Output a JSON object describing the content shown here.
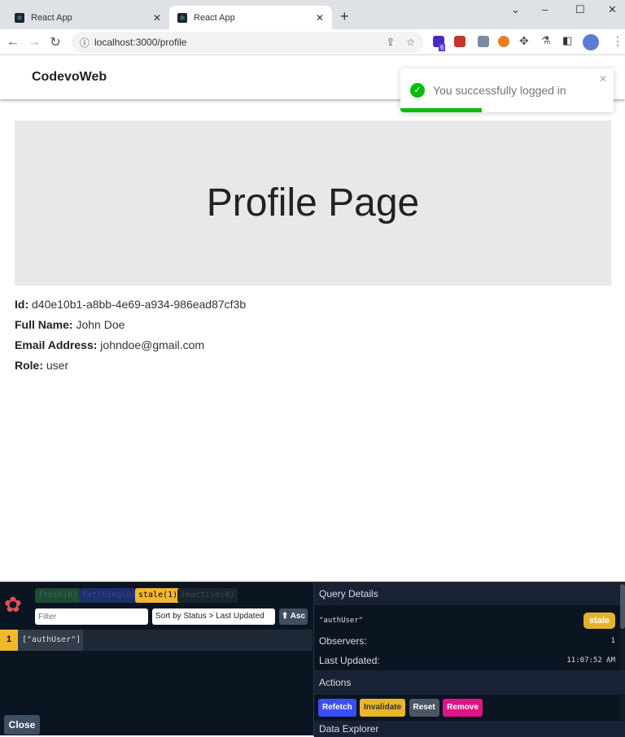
{
  "browser": {
    "tabs": [
      {
        "title": "React App"
      },
      {
        "title": "React App"
      }
    ],
    "url": "localhost:3000/profile",
    "extension_badge": "6"
  },
  "app": {
    "brand": "CodevoWeb"
  },
  "toast": {
    "message": "You successfully logged in",
    "progress": 0.38,
    "color": "#07bc0c"
  },
  "hero": {
    "title": "Profile Page"
  },
  "profile": [
    {
      "label": "Id:",
      "value": "d40e10b1-a8bb-4e69-a934-986ead87cf3b"
    },
    {
      "label": "Full Name:",
      "value": "John Doe"
    },
    {
      "label": "Email Address:",
      "value": "johndoe@gmail.com"
    },
    {
      "label": "Role:",
      "value": "user"
    }
  ],
  "devtools": {
    "status_badges": [
      {
        "label": "fresh",
        "count": "(0)"
      },
      {
        "label": "fetching",
        "count": "(0)"
      },
      {
        "label": "stale",
        "count": "(1)"
      },
      {
        "label": "inactive",
        "count": "(0)"
      }
    ],
    "filter_placeholder": "Filter",
    "sort_label": "Sort by Status > Last Updated",
    "asc_label": "⬆ Asc",
    "queries": [
      {
        "observers": "1",
        "key": "[\"authUser\"]"
      }
    ],
    "close_label": "Close",
    "details": {
      "title": "Query Details",
      "key": "\"authUser\"",
      "status": "stale",
      "observers_label": "Observers:",
      "observers": "1",
      "last_updated_label": "Last Updated:",
      "last_updated": "11:07:52 AM",
      "actions_title": "Actions",
      "actions": [
        "Refetch",
        "Invalidate",
        "Reset",
        "Remove"
      ],
      "explorer_title": "Data Explorer"
    }
  }
}
